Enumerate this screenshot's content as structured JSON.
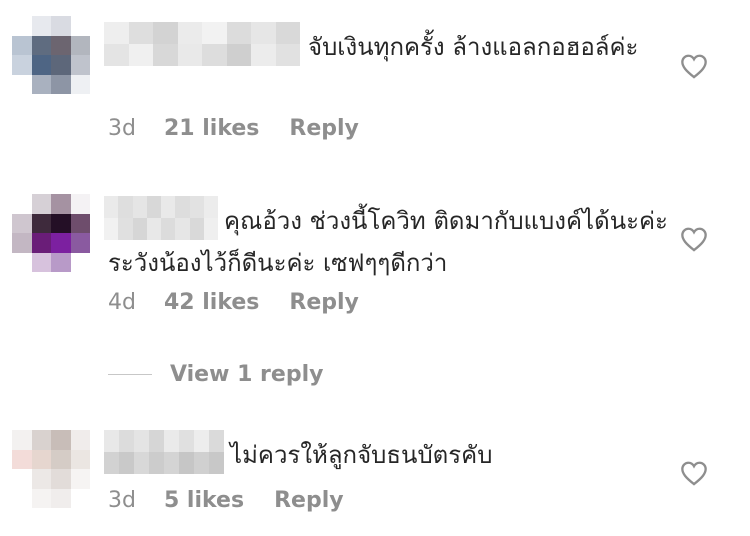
{
  "comments": [
    {
      "text": "จับเงินทุกครั้ง ล้างแอลกอฮอล์ค่ะ",
      "time": "3d",
      "likes": "21 likes",
      "reply": "Reply"
    },
    {
      "text": "คุณอ้วง ช่วงนี้โควิท ติดมากับแบงค์ได้นะค่ะ ระวังน้องไว้ก็ดีนะค่ะ เซฟๆๆดีกว่า",
      "time": "4d",
      "likes": "42 likes",
      "reply": "Reply"
    },
    {
      "text": "ไม่ควรให้ลูกจับธนบัตรคับ",
      "time": "3d",
      "likes": "5 likes",
      "reply": "Reply"
    }
  ],
  "view_replies": "View 1 reply",
  "colors": {
    "text": "#262626",
    "muted": "#8e8e8e",
    "divider": "#c7c7c7",
    "heart": "#8e8e8e"
  },
  "icons": {
    "like": "heart-outline-icon"
  }
}
